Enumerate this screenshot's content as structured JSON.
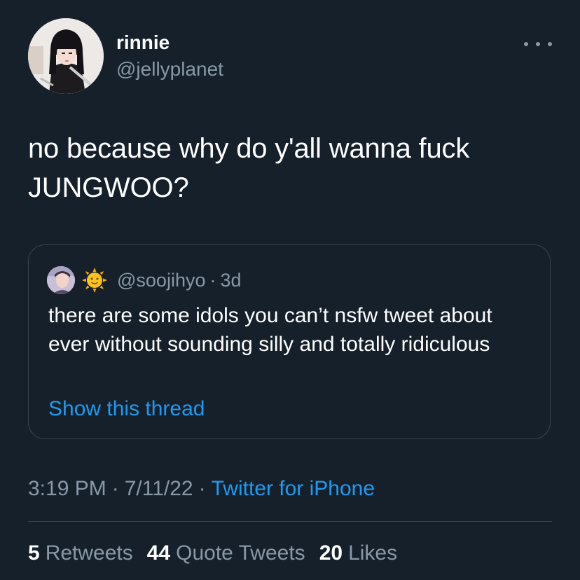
{
  "tweet": {
    "author": {
      "display_name": "rinnie",
      "handle": "@jellyplanet"
    },
    "text_line1": "no because why do y'all wanna fuck",
    "text_line2": "JUNGWOO?",
    "more_icon": "ellipsis-icon"
  },
  "quote": {
    "emoji": "sun-with-face-emoji",
    "handle": "@soojihyo",
    "dot": "·",
    "time": "3d",
    "text": "there are some idols you can’t nsfw tweet about ever without sounding silly and totally ridiculous",
    "show_thread": "Show this thread"
  },
  "meta": {
    "time": "3:19 PM",
    "sep1": "·",
    "date": "7/11/22",
    "sep2": "·",
    "source": "Twitter for iPhone"
  },
  "stats": {
    "retweets_count": "5",
    "retweets_label": "Retweets",
    "quotes_count": "44",
    "quotes_label": "Quote Tweets",
    "likes_count": "20",
    "likes_label": "Likes"
  },
  "colors": {
    "background": "#15202b",
    "secondary_text": "#8899a6",
    "link": "#1d9bf0",
    "border": "#38444d"
  }
}
